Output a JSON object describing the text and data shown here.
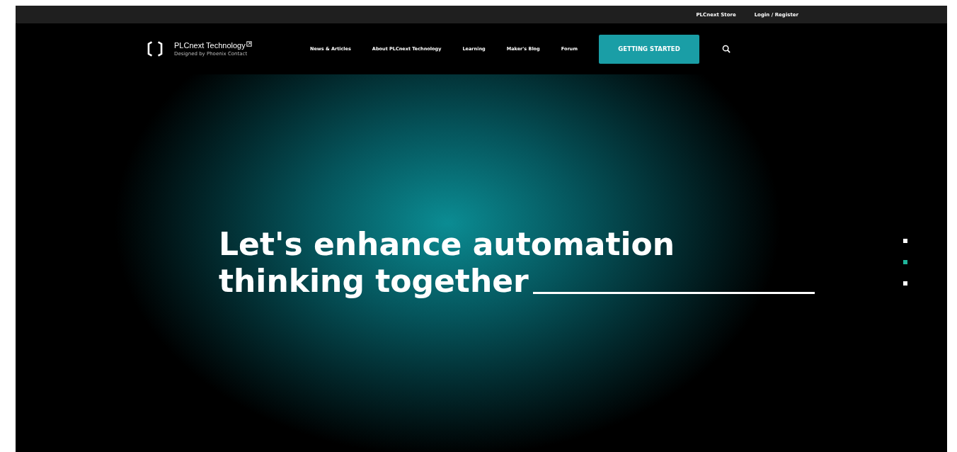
{
  "top_bar": {
    "links": [
      "PLCnext Store",
      "Login / Register"
    ]
  },
  "header": {
    "logo": {
      "name": "PLCnext Technology",
      "tagline": "Designed by Phoenix Contact"
    },
    "nav": [
      "News & Articles",
      "About PLCnext Technology",
      "Learning",
      "Maker's Blog",
      "Forum"
    ],
    "cta": "GETTING STARTED"
  },
  "hero": {
    "headline_lines": [
      "Let's enhance automation",
      "thinking together"
    ],
    "slides": [
      {
        "selected": false
      },
      {
        "selected": true
      },
      {
        "selected": false
      }
    ]
  }
}
